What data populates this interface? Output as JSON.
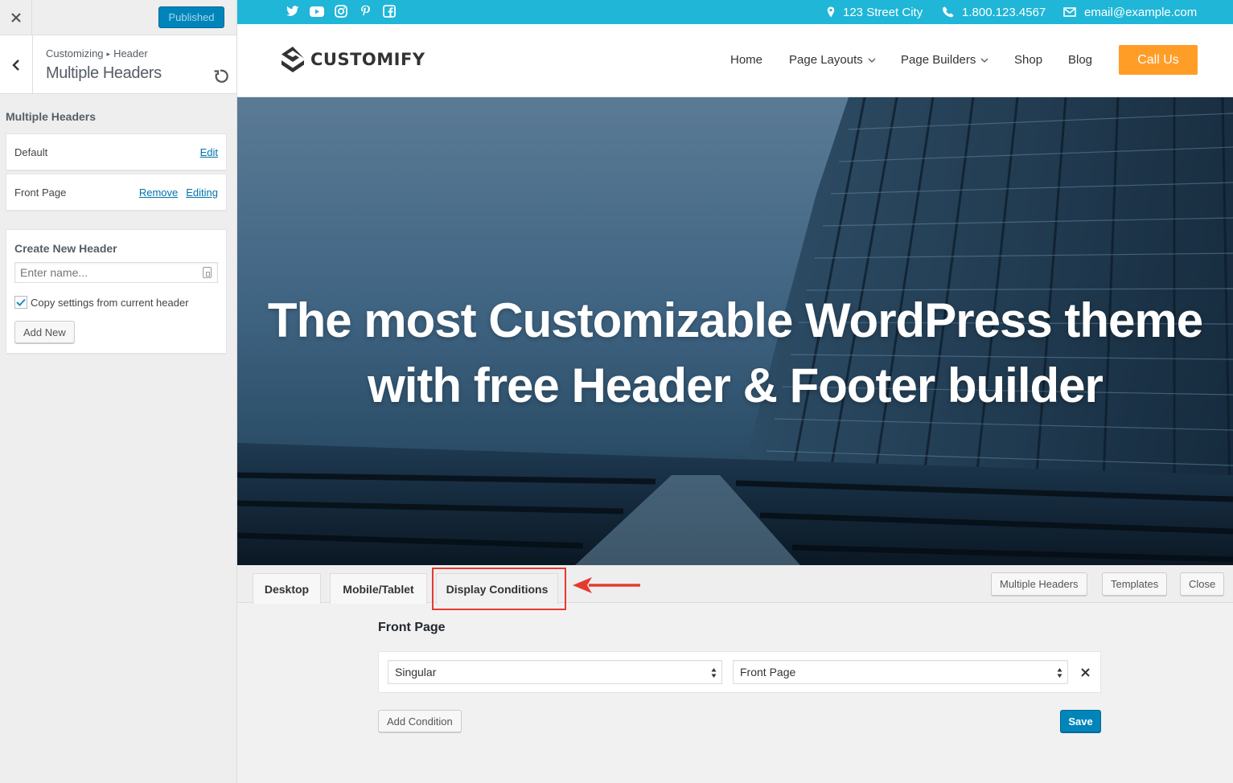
{
  "sidebar": {
    "published_label": "Published",
    "breadcrumb_parent": "Customizing",
    "breadcrumb_current": "Header",
    "section_title": "Multiple Headers",
    "list_label": "Multiple Headers",
    "headers": [
      {
        "name": "Default",
        "actions": [
          "Edit"
        ]
      },
      {
        "name": "Front Page",
        "actions": [
          "Remove",
          "Editing"
        ]
      }
    ],
    "create": {
      "title": "Create New Header",
      "placeholder": "Enter name...",
      "checkbox_label": "Copy settings from current header",
      "checkbox_checked": true,
      "add_label": "Add New"
    }
  },
  "topbar": {
    "color": "#1fb6d7",
    "social_icons": [
      "twitter-icon",
      "youtube-icon",
      "instagram-icon",
      "pinterest-icon",
      "facebook-icon"
    ],
    "address": "123 Street City",
    "phone": "1.800.123.4567",
    "email": "email@example.com"
  },
  "header": {
    "logo_text": "CUSTOMIFY",
    "nav": [
      {
        "label": "Home",
        "dropdown": false
      },
      {
        "label": "Page Layouts",
        "dropdown": true
      },
      {
        "label": "Page Builders",
        "dropdown": true
      },
      {
        "label": "Shop",
        "dropdown": false
      },
      {
        "label": "Blog",
        "dropdown": false
      }
    ],
    "cta_label": "Call Us ",
    "cta_color": "#ff9d27"
  },
  "hero": {
    "line1": "The most Customizable WordPress theme",
    "line2": "with free Header & Footer builder"
  },
  "builder": {
    "tabs": [
      "Desktop",
      "Mobile/Tablet",
      "Display Conditions"
    ],
    "active_tab": "Display Conditions",
    "right_buttons": [
      "Multiple Headers",
      "Templates",
      "Close"
    ],
    "condition_title": "Front Page",
    "condition": {
      "type": "Singular",
      "value": "Front Page"
    },
    "add_condition_label": "Add Condition",
    "save_label": "Save",
    "accent": "#0085ba",
    "highlight_color": "#e53b2f"
  }
}
